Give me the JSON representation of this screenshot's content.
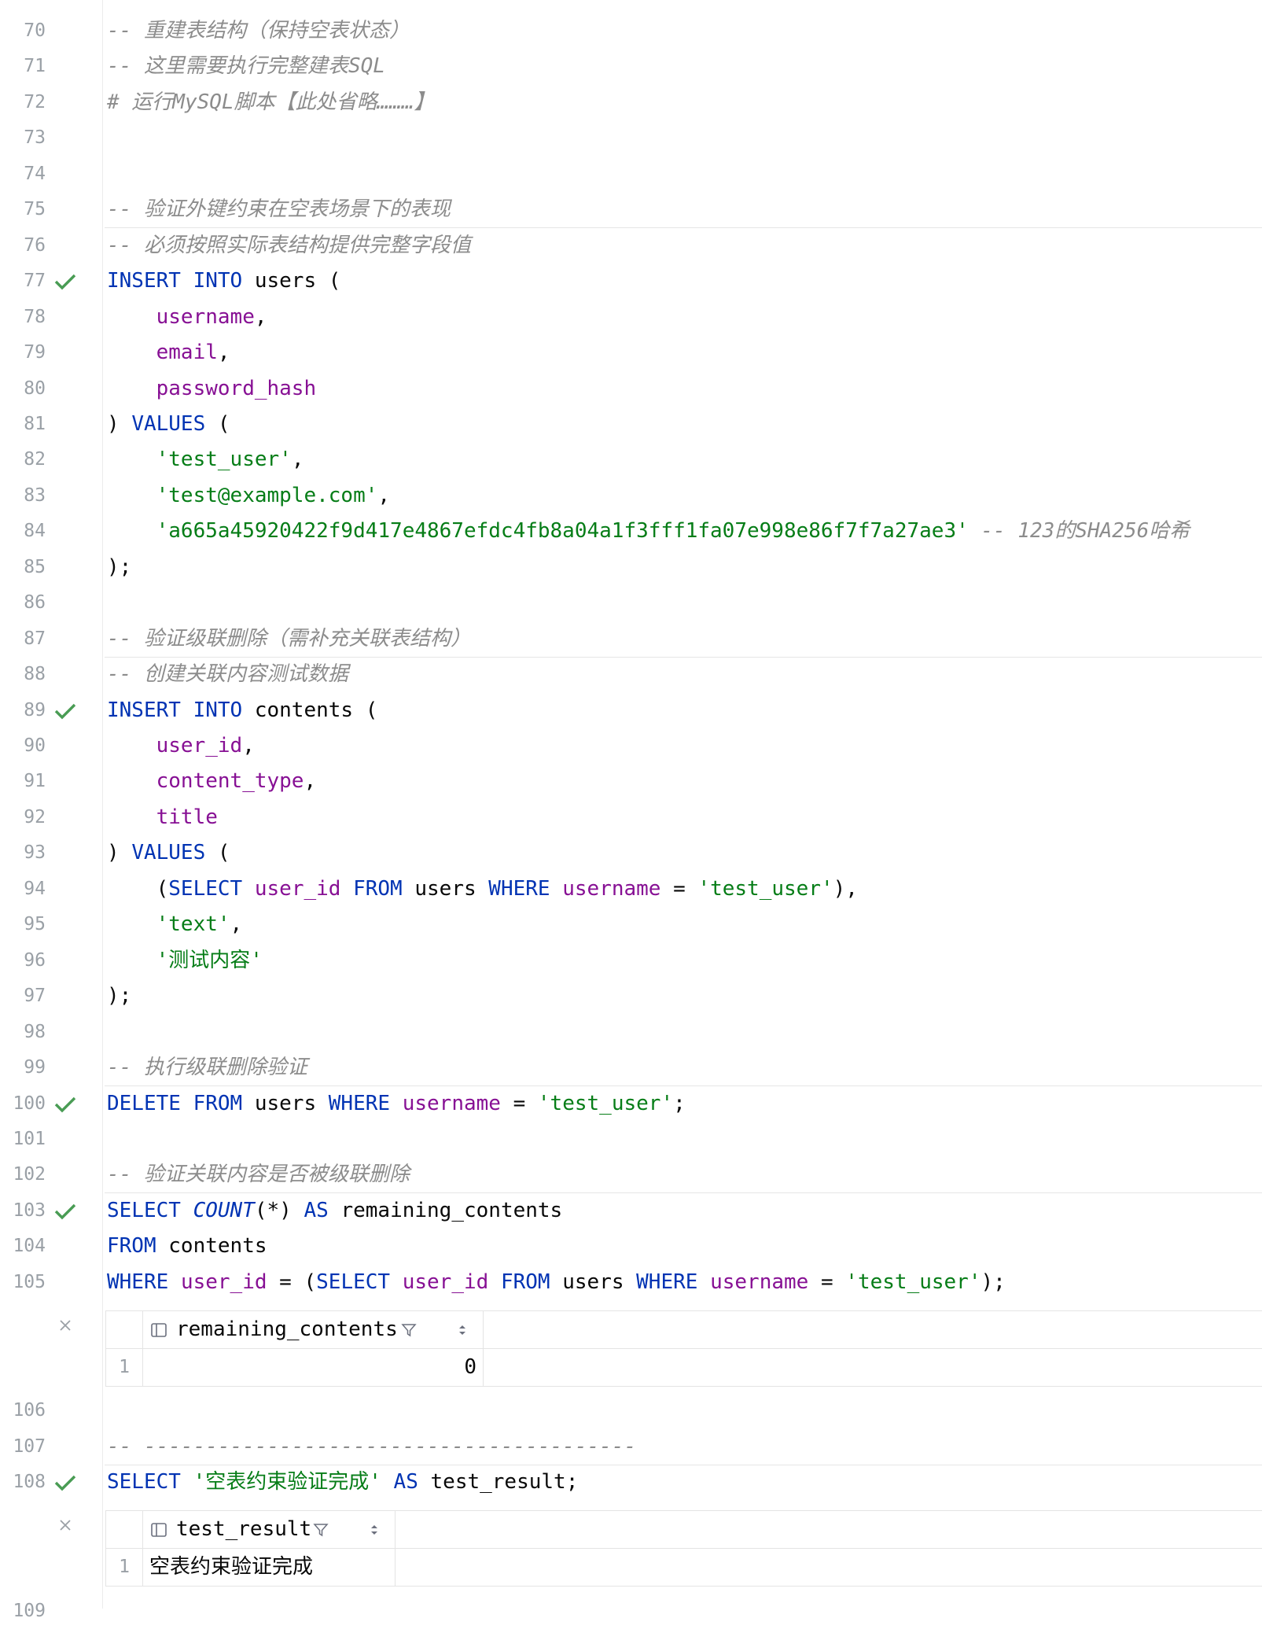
{
  "lines": [
    {
      "num": "70",
      "check": false,
      "tokens": [
        {
          "t": "-- 重建表结构（保持空表状态）",
          "c": "cm"
        }
      ]
    },
    {
      "num": "71",
      "check": false,
      "tokens": [
        {
          "t": "-- 这里需要执行完整建表SQL",
          "c": "cm"
        }
      ]
    },
    {
      "num": "72",
      "check": false,
      "tokens": [
        {
          "t": "# 运行MySQL脚本【此处省略………】",
          "c": "cm"
        }
      ]
    },
    {
      "num": "73",
      "check": false,
      "tokens": []
    },
    {
      "num": "74",
      "check": false,
      "tokens": []
    },
    {
      "num": "75",
      "check": false,
      "tokens": [
        {
          "t": "-- 验证外键约束在空表场景下的表现",
          "c": "cm"
        }
      ]
    },
    {
      "num": "76",
      "check": false,
      "tokens": [
        {
          "t": "-- 必须按照实际表结构提供完整字段值",
          "c": "cm"
        }
      ]
    },
    {
      "num": "77",
      "check": true,
      "tokens": [
        {
          "t": "INSERT INTO",
          "c": "kw"
        },
        {
          "t": " users (",
          "c": ""
        }
      ]
    },
    {
      "num": "78",
      "check": false,
      "tokens": [
        {
          "t": "    ",
          "c": ""
        },
        {
          "t": "username",
          "c": "col"
        },
        {
          "t": ",",
          "c": ""
        }
      ]
    },
    {
      "num": "79",
      "check": false,
      "tokens": [
        {
          "t": "    ",
          "c": ""
        },
        {
          "t": "email",
          "c": "col"
        },
        {
          "t": ",",
          "c": ""
        }
      ]
    },
    {
      "num": "80",
      "check": false,
      "tokens": [
        {
          "t": "    ",
          "c": ""
        },
        {
          "t": "password_hash",
          "c": "col"
        }
      ]
    },
    {
      "num": "81",
      "check": false,
      "tokens": [
        {
          "t": ") ",
          "c": ""
        },
        {
          "t": "VALUES",
          "c": "kw"
        },
        {
          "t": " (",
          "c": ""
        }
      ]
    },
    {
      "num": "82",
      "check": false,
      "tokens": [
        {
          "t": "    ",
          "c": ""
        },
        {
          "t": "'test_user'",
          "c": "str"
        },
        {
          "t": ",",
          "c": ""
        }
      ]
    },
    {
      "num": "83",
      "check": false,
      "tokens": [
        {
          "t": "    ",
          "c": ""
        },
        {
          "t": "'test@example.com'",
          "c": "str"
        },
        {
          "t": ",",
          "c": ""
        }
      ]
    },
    {
      "num": "84",
      "check": false,
      "tokens": [
        {
          "t": "    ",
          "c": ""
        },
        {
          "t": "'a665a45920422f9d417e4867efdc4fb8a04a1f3fff1fa07e998e86f7f7a27ae3'",
          "c": "str"
        },
        {
          "t": " -- 123的SHA256哈希",
          "c": "cm"
        }
      ]
    },
    {
      "num": "85",
      "check": false,
      "tokens": [
        {
          "t": ");",
          "c": ""
        }
      ]
    },
    {
      "num": "86",
      "check": false,
      "tokens": []
    },
    {
      "num": "87",
      "check": false,
      "tokens": [
        {
          "t": "-- 验证级联删除（需补充关联表结构）",
          "c": "cm"
        }
      ]
    },
    {
      "num": "88",
      "check": false,
      "tokens": [
        {
          "t": "-- 创建关联内容测试数据",
          "c": "cm"
        }
      ]
    },
    {
      "num": "89",
      "check": true,
      "tokens": [
        {
          "t": "INSERT INTO",
          "c": "kw"
        },
        {
          "t": " contents (",
          "c": ""
        }
      ]
    },
    {
      "num": "90",
      "check": false,
      "tokens": [
        {
          "t": "    ",
          "c": ""
        },
        {
          "t": "user_id",
          "c": "col"
        },
        {
          "t": ",",
          "c": ""
        }
      ]
    },
    {
      "num": "91",
      "check": false,
      "tokens": [
        {
          "t": "    ",
          "c": ""
        },
        {
          "t": "content_type",
          "c": "col"
        },
        {
          "t": ",",
          "c": ""
        }
      ]
    },
    {
      "num": "92",
      "check": false,
      "tokens": [
        {
          "t": "    ",
          "c": ""
        },
        {
          "t": "title",
          "c": "col"
        }
      ]
    },
    {
      "num": "93",
      "check": false,
      "tokens": [
        {
          "t": ") ",
          "c": ""
        },
        {
          "t": "VALUES",
          "c": "kw"
        },
        {
          "t": " (",
          "c": ""
        }
      ]
    },
    {
      "num": "94",
      "check": false,
      "tokens": [
        {
          "t": "    (",
          "c": ""
        },
        {
          "t": "SELECT",
          "c": "kw"
        },
        {
          "t": " ",
          "c": ""
        },
        {
          "t": "user_id",
          "c": "col"
        },
        {
          "t": " ",
          "c": ""
        },
        {
          "t": "FROM",
          "c": "kw"
        },
        {
          "t": " users ",
          "c": ""
        },
        {
          "t": "WHERE",
          "c": "kw"
        },
        {
          "t": " ",
          "c": ""
        },
        {
          "t": "username",
          "c": "col"
        },
        {
          "t": " = ",
          "c": ""
        },
        {
          "t": "'test_user'",
          "c": "str"
        },
        {
          "t": "),",
          "c": ""
        }
      ]
    },
    {
      "num": "95",
      "check": false,
      "tokens": [
        {
          "t": "    ",
          "c": ""
        },
        {
          "t": "'text'",
          "c": "str"
        },
        {
          "t": ",",
          "c": ""
        }
      ]
    },
    {
      "num": "96",
      "check": false,
      "tokens": [
        {
          "t": "    ",
          "c": ""
        },
        {
          "t": "'测试内容'",
          "c": "str"
        }
      ]
    },
    {
      "num": "97",
      "check": false,
      "tokens": [
        {
          "t": ");",
          "c": ""
        }
      ]
    },
    {
      "num": "98",
      "check": false,
      "tokens": []
    },
    {
      "num": "99",
      "check": false,
      "tokens": [
        {
          "t": "-- 执行级联删除验证",
          "c": "cm"
        }
      ]
    },
    {
      "num": "100",
      "check": true,
      "tokens": [
        {
          "t": "DELETE FROM",
          "c": "kw"
        },
        {
          "t": " users ",
          "c": ""
        },
        {
          "t": "WHERE",
          "c": "kw"
        },
        {
          "t": " ",
          "c": ""
        },
        {
          "t": "username",
          "c": "col"
        },
        {
          "t": " = ",
          "c": ""
        },
        {
          "t": "'test_user'",
          "c": "str"
        },
        {
          "t": ";",
          "c": ""
        }
      ]
    },
    {
      "num": "101",
      "check": false,
      "tokens": []
    },
    {
      "num": "102",
      "check": false,
      "tokens": [
        {
          "t": "-- 验证关联内容是否被级联删除",
          "c": "cm"
        }
      ]
    },
    {
      "num": "103",
      "check": true,
      "tokens": [
        {
          "t": "SELECT",
          "c": "kw"
        },
        {
          "t": " ",
          "c": ""
        },
        {
          "t": "COUNT",
          "c": "fn"
        },
        {
          "t": "(*) ",
          "c": ""
        },
        {
          "t": "AS",
          "c": "kw"
        },
        {
          "t": " remaining_contents",
          "c": ""
        }
      ]
    },
    {
      "num": "104",
      "check": false,
      "tokens": [
        {
          "t": "FROM",
          "c": "kw"
        },
        {
          "t": " contents",
          "c": ""
        }
      ]
    },
    {
      "num": "105",
      "check": false,
      "tokens": [
        {
          "t": "WHERE",
          "c": "kw"
        },
        {
          "t": " ",
          "c": ""
        },
        {
          "t": "user_id",
          "c": "col"
        },
        {
          "t": " = (",
          "c": ""
        },
        {
          "t": "SELECT",
          "c": "kw"
        },
        {
          "t": " ",
          "c": ""
        },
        {
          "t": "user_id",
          "c": "col"
        },
        {
          "t": " ",
          "c": ""
        },
        {
          "t": "FROM",
          "c": "kw"
        },
        {
          "t": " users ",
          "c": ""
        },
        {
          "t": "WHERE",
          "c": "kw"
        },
        {
          "t": " ",
          "c": ""
        },
        {
          "t": "username",
          "c": "col"
        },
        {
          "t": " = ",
          "c": ""
        },
        {
          "t": "'test_user'",
          "c": "str"
        },
        {
          "t": ");",
          "c": ""
        }
      ]
    },
    {
      "num": "106",
      "check": false,
      "tokens": []
    },
    {
      "num": "107",
      "check": false,
      "tokens": [
        {
          "t": "-- ----------------------------------------",
          "c": "cm"
        }
      ]
    },
    {
      "num": "108",
      "check": true,
      "tokens": [
        {
          "t": "SELECT",
          "c": "kw"
        },
        {
          "t": " ",
          "c": ""
        },
        {
          "t": "'空表约束验证完成'",
          "c": "str"
        },
        {
          "t": " ",
          "c": ""
        },
        {
          "t": "AS",
          "c": "kw"
        },
        {
          "t": " test_result;",
          "c": ""
        }
      ]
    },
    {
      "num": "109",
      "check": false,
      "tokens": []
    }
  ],
  "results": [
    {
      "column": "remaining_contents",
      "row_number": "1",
      "value": "0",
      "align": "right"
    },
    {
      "column": "test_result",
      "row_number": "1",
      "value": "空表约束验证完成",
      "align": "left"
    }
  ],
  "colors": {
    "check": "#499c54",
    "keyword": "#0033b3",
    "column": "#871094",
    "string": "#067d17",
    "comment": "#8c8c8c"
  }
}
